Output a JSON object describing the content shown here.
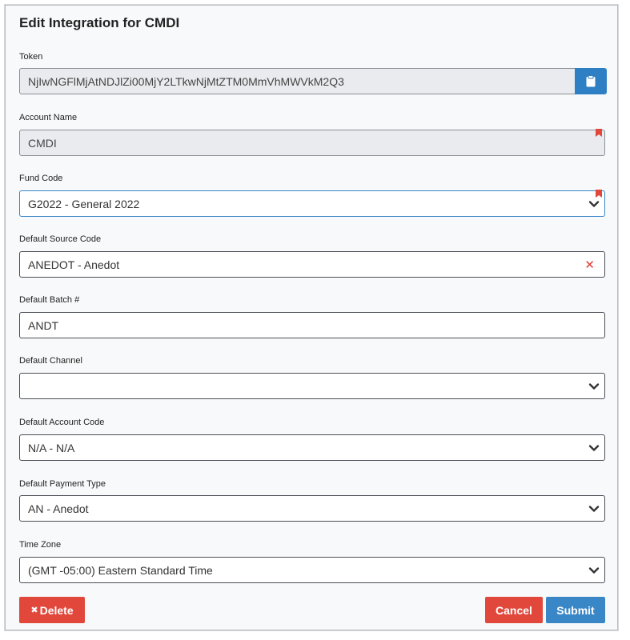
{
  "dialog": {
    "title": "Edit Integration for CMDI"
  },
  "token": {
    "label": "Token",
    "value": "NjIwNGFlMjAtNDJlZi00MjY2LTkwNjMtZTM0MmVhMWVkM2Q3",
    "copy_icon": "clipboard-icon"
  },
  "account_name": {
    "label": "Account Name",
    "value": "CMDI"
  },
  "fund_code": {
    "label": "Fund Code",
    "value": "G2022 - General 2022"
  },
  "source_code": {
    "label": "Default Source Code",
    "value": "ANEDOT - Anedot",
    "clear_glyph": "✕"
  },
  "batch": {
    "label": "Default Batch #",
    "value": "ANDT"
  },
  "channel": {
    "label": "Default Channel",
    "value": ""
  },
  "account_code": {
    "label": "Default Account Code",
    "value": "N/A - N/A"
  },
  "payment_type": {
    "label": "Default Payment Type",
    "value": "AN - Anedot"
  },
  "time_zone": {
    "label": "Time Zone",
    "value": "(GMT -05:00) Eastern Standard Time"
  },
  "buttons": {
    "delete_label": "Delete",
    "delete_glyph": "✖",
    "cancel_label": "Cancel",
    "submit_label": "Submit"
  },
  "colors": {
    "primary": "#3a87c8",
    "danger": "#e1483b",
    "required_flag": "#e1483b"
  }
}
